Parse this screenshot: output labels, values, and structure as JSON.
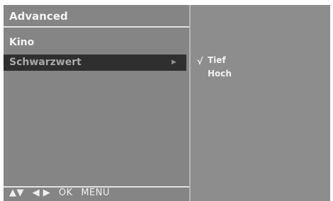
{
  "menu": {
    "title": "Advanced",
    "items": [
      {
        "label": "Kino"
      },
      {
        "label": "Schwarzwert",
        "arrow": "▶"
      }
    ]
  },
  "submenu": {
    "check_mark": "√",
    "options": [
      {
        "label": "Tief",
        "checked": true
      },
      {
        "label": "Hoch",
        "checked": false
      }
    ]
  },
  "footer": {
    "nav_updown": "▲▼",
    "nav_leftright": "◀ ▶",
    "ok": "OK",
    "menu": "MENU"
  }
}
